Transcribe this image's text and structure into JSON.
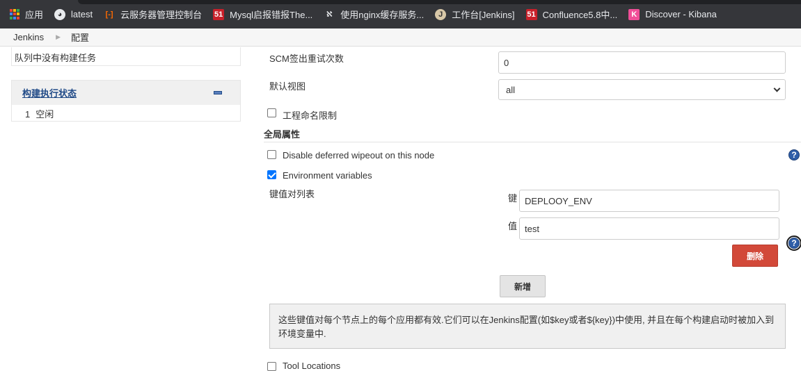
{
  "bookmarks": [
    {
      "label": "应用",
      "icon": "apps-grid-icon"
    },
    {
      "label": "latest",
      "icon": "github-icon"
    },
    {
      "label": "云服务器管理控制台",
      "icon": "aliyun-icon"
    },
    {
      "label": "Mysql启报错报The...",
      "icon": "51cto-icon"
    },
    {
      "label": "使用nginx缓存服务...",
      "icon": "nginx-icon"
    },
    {
      "label": "工作台[Jenkins]",
      "icon": "jenkins-icon"
    },
    {
      "label": "Confluence5.8中...",
      "icon": "51cto-icon"
    },
    {
      "label": "Discover - Kibana",
      "icon": "kibana-icon"
    }
  ],
  "icon_glyphs": {
    "github": "◕",
    "aliyun": "[-]",
    "51": "51",
    "nginx": "ℵ",
    "jenkins": "J",
    "kibana": "K"
  },
  "breadcrumb": {
    "root": "Jenkins",
    "current": "配置"
  },
  "sidebar": {
    "queue_text": "队列中没有构建任务",
    "executor_title": "构建执行状态",
    "executor_number": "1",
    "executor_status": "空闲"
  },
  "form": {
    "scm_retry_label": "SCM签出重试次数",
    "scm_retry_value": "0",
    "default_view_label": "默认视图",
    "default_view_value": "all",
    "naming_restriction_label": "工程命名限制",
    "naming_restriction_checked": false,
    "global_props_title": "全局属性",
    "disable_wipeout_label": "Disable deferred wipeout on this node",
    "disable_wipeout_checked": false,
    "env_vars_label": "Environment variables",
    "env_vars_checked": true,
    "kv_list_label": "键值对列表",
    "key_label": "键",
    "key_value": "DEPLOOY_ENV",
    "value_label": "值",
    "value_value": "test",
    "delete_button": "删除",
    "add_button": "新增",
    "help_text": "这些键值对每个节点上的每个应用都有效.它们可以在Jenkins配置(如$key或者${key})中使用, 并且在每个构建启动时被加入到环境变量中.",
    "help_glyph": "?",
    "truncated_label": "Tool Locations"
  },
  "colors": {
    "accent": "#0075ff",
    "danger": "#d24939",
    "link": "#204a87",
    "chrome_bar": "#35363a"
  }
}
